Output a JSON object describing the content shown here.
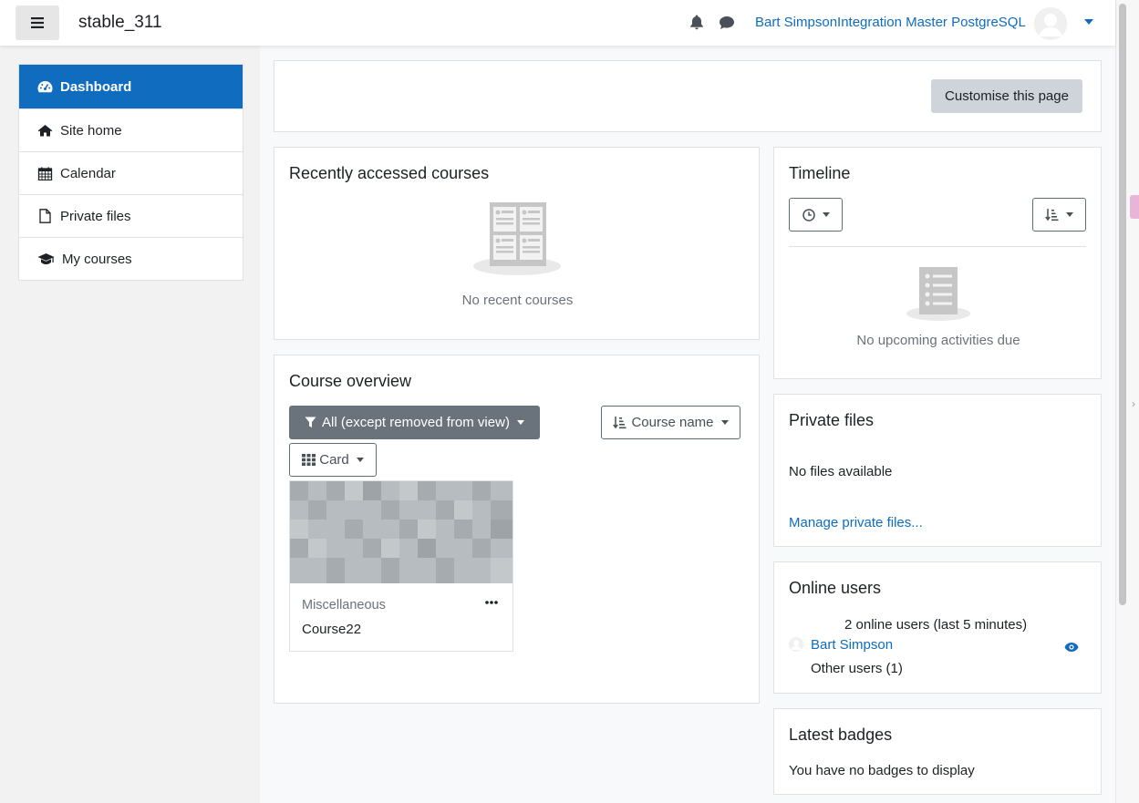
{
  "navbar": {
    "site_name": "stable_311",
    "user_name": "Bart SimpsonIntegration Master PostgreSQL",
    "icons": [
      "bars-icon",
      "bell-icon",
      "comment-icon",
      "chevron-down-icon"
    ]
  },
  "nav": {
    "items": [
      {
        "label": "Dashboard",
        "icon": "tachometer-icon",
        "active": true
      },
      {
        "label": "Site home",
        "icon": "home-icon"
      },
      {
        "label": "Calendar",
        "icon": "calendar-icon"
      },
      {
        "label": "Private files",
        "icon": "file-icon"
      },
      {
        "label": "My courses",
        "icon": "graduation-cap-icon"
      }
    ]
  },
  "page": {
    "customise_button": "Customise this page"
  },
  "recent": {
    "title": "Recently accessed courses",
    "empty": "No recent courses"
  },
  "overview": {
    "title": "Course overview",
    "filter_label": "All (except removed from view)",
    "sort_label": "Course name",
    "view_label": "Card",
    "course": {
      "category": "Miscellaneous",
      "name": "Course22"
    }
  },
  "timeline": {
    "title": "Timeline",
    "empty": "No upcoming activities due"
  },
  "private_files": {
    "title": "Private files",
    "empty": "No files available",
    "manage_link": "Manage private files..."
  },
  "online_users": {
    "title": "Online users",
    "summary": "2 online users (last 5 minutes)",
    "user": "Bart Simpson",
    "others": "Other users (1)"
  },
  "badges": {
    "title": "Latest badges",
    "empty": "You have no badges to display"
  },
  "colors": {
    "primary": "#0f6cbf",
    "secondary_btn": "#ced4da",
    "filter_btn": "#6a737b"
  }
}
